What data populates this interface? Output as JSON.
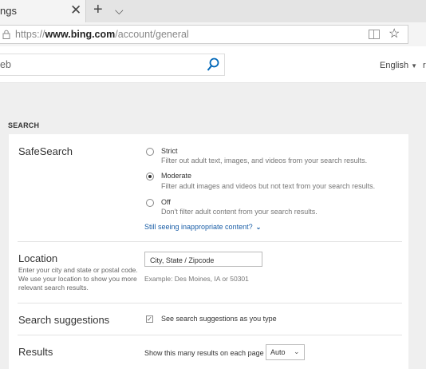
{
  "browser": {
    "tab_title": "ngs",
    "url_prefix": "https://",
    "url_domain": "www.bing.com",
    "url_path": "/account/general"
  },
  "header": {
    "search_value": "eb",
    "language_label": "English",
    "trailing_text": "r"
  },
  "settings": {
    "section_title": "SEARCH",
    "safesearch": {
      "label": "SafeSearch",
      "options": [
        {
          "title": "Strict",
          "description": "Filter out adult text, images, and videos from your search results.",
          "checked": false
        },
        {
          "title": "Moderate",
          "description": "Filter adult images and videos but not text from your search results.",
          "checked": true
        },
        {
          "title": "Off",
          "description": "Don't filter adult content from your search results.",
          "checked": false
        }
      ],
      "link_text": "Still seeing inappropriate content?"
    },
    "location": {
      "label": "Location",
      "description": "Enter your city and state or postal code. We use your location to show you more relevant search results.",
      "placeholder": "City, State / Zipcode",
      "example": "Example: Des Moines, IA or 50301"
    },
    "suggestions": {
      "label": "Search suggestions",
      "checkbox_label": "See search suggestions as you type",
      "checked": true
    },
    "results": {
      "label": "Results",
      "prompt": "Show this many results on each page",
      "selected": "Auto"
    }
  }
}
